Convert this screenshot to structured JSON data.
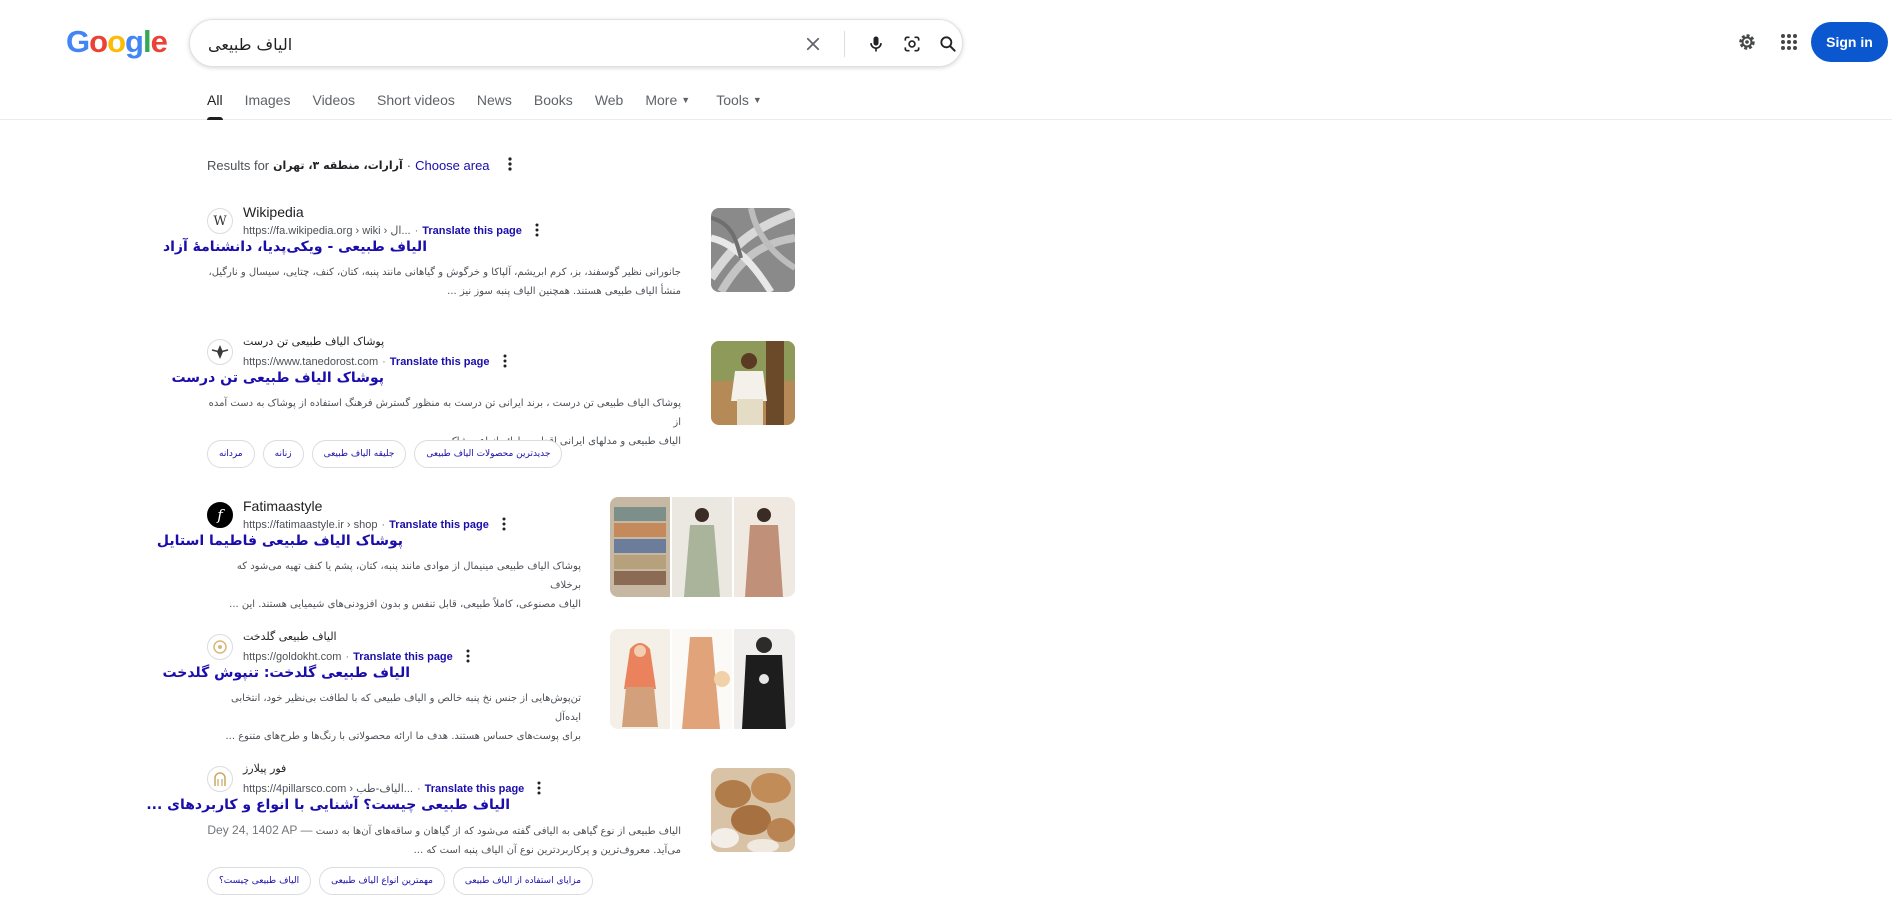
{
  "logo_letters": [
    "G",
    "o",
    "o",
    "g",
    "l",
    "e"
  ],
  "search": {
    "query": "الیاف طبیعی",
    "clear_icon": "close-icon",
    "voice_icon": "mic-icon",
    "lens_icon": "camera-lens-icon",
    "search_icon": "search-icon"
  },
  "header": {
    "settings_icon": "gear-icon",
    "apps_icon": "apps-grid-icon",
    "signin_label": "Sign in"
  },
  "tabs": [
    {
      "label": "All",
      "active": true
    },
    {
      "label": "Images"
    },
    {
      "label": "Videos"
    },
    {
      "label": "Short videos"
    },
    {
      "label": "News"
    },
    {
      "label": "Books"
    },
    {
      "label": "Web"
    },
    {
      "label": "More",
      "caret": true
    },
    {
      "label": "Tools",
      "caret": true
    }
  ],
  "location": {
    "prefix": "Results for",
    "place": "آرارات، منطقه ۳، تهران",
    "separator": "·",
    "choose_area": "Choose area"
  },
  "results": [
    {
      "site_name": "Wikipedia",
      "url": "https://fa.wikipedia.org › wiki › ال...",
      "translate": "Translate this page",
      "title": "الیاف طبیعی - ویکی‌پدیا، دانشنامهٔ آزاد",
      "snippet_lines": [
        "جانورانی نظیر گوسفند، بز، کرم ابریشم، آلپاکا و خرگوش و گیاهانی مانند پنبه، کتان، کنف، چتایی، سیسال و نارگیل،",
        "منشأ الیاف طبیعی هستند. همچنین الیاف پنبه سوز نیز ..."
      ]
    },
    {
      "site_name": "پوشاک الیاف طبیعی تن درست",
      "url": "https://www.tanedorost.com",
      "translate": "Translate this page",
      "title": "پوشاک الیاف طبیعی تن درست",
      "snippet_lines": [
        "پوشاک الیاف طبیعی تن درست ، برند ایرانی تن درست به منظور گسترش فرهنگ استفاده از پوشاک به دست آمده از",
        "الیاف طبیعی و مدلهای ایرانی اقدام به ارائه انواع پوشاک ..."
      ],
      "chips": [
        "جدیدترین محصولات الیاف طبیعی",
        "جلیقه الیاف طبیعی",
        "زنانه",
        "مردانه"
      ]
    },
    {
      "site_name": "Fatimaastyle",
      "url": "https://fatimaastyle.ir › shop",
      "translate": "Translate this page",
      "title": "پوشاک الیاف طبیعی فاطیما استایل",
      "snippet_lines": [
        "پوشاک الیاف طبیعی مینیمال از موادی مانند پنبه، کتان، پشم یا کنف تهیه می‌شود که برخلاف",
        "الیاف مصنوعی، کاملاً طبیعی، قابل تنفس و بدون افزودنی‌های شیمیایی هستند. این ..."
      ]
    },
    {
      "site_name": "الیاف طبیعی گلدخت",
      "url": "https://goldokht.com",
      "translate": "Translate this page",
      "title": "الیاف طبیعی گلدخت: تنپوش گلدخت",
      "snippet_lines": [
        "تن‌پوش‌هایی از جنس نخ پنبه خالص و الیاف طبیعی که با لطافت بی‌نظیر خود، انتخابی ایده‌آل",
        "برای پوست‌های حساس هستند. هدف ما ارائه محصولاتی با رنگ‌ها و طرح‌های متنوع ..."
      ]
    },
    {
      "site_name": "فور پیلارز",
      "url": "https://4pillarsco.com › الیاف-طب...",
      "translate": "Translate this page",
      "title": "الیاف طبیعی چیست؟ آشنایی با انواع و کاربردهای ...",
      "date": "Dey 24, 1402 AP —",
      "snippet_lines": [
        "الیاف طبیعی از نوع گیاهی به الیافی گفته می‌شود که از گیاهان و ساقه‌های آن‌ها به دست",
        "می‌آید. معروف‌ترین و پرکاربردترین نوع آن الیاف پنبه است که ..."
      ],
      "chips": [
        "مزایای استفاده از الیاف طبیعی",
        "مهمترین انواع الیاف طبیعی",
        "الیاف طبیعی چیست؟"
      ]
    }
  ]
}
